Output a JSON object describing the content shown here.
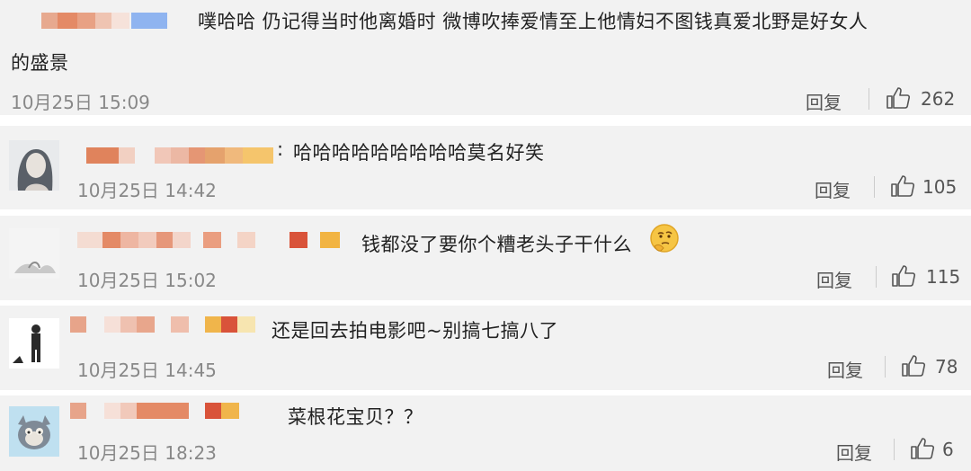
{
  "comments": [
    {
      "text_line1": "噗哈哈 仍记得当时他离婚时 微博吹捧爱情至上他情妇不图钱真爱北野是好女人",
      "text_line2": "的盛景",
      "time": "10月25日 15:09",
      "reply_label": "回复",
      "likes": "262"
    }
  ],
  "replies": [
    {
      "separator": ":",
      "text": "哈哈哈哈哈哈哈哈哈莫名好笑",
      "time": "10月25日 14:42",
      "reply_label": "回复",
      "likes": "105"
    },
    {
      "text": "钱都没了要你个糟老头子干什么",
      "emoji": "thinking-face",
      "time": "10月25日 15:02",
      "reply_label": "回复",
      "likes": "115"
    },
    {
      "text": "还是回去拍电影吧~别搞七搞八了",
      "time": "10月25日 14:45",
      "reply_label": "回复",
      "likes": "78"
    },
    {
      "text": "菜根花宝贝？？",
      "time": "10月25日 18:23",
      "reply_label": "回复",
      "likes": "6"
    }
  ],
  "icons": {
    "like": "thumbs-up-icon"
  },
  "colors": {
    "card_bg": "#f2f2f2",
    "time_gray": "#888888",
    "mosaic_orange": "#e0835c",
    "mosaic_pink": "#f0c4b4",
    "mosaic_blue": "#8fb4f0",
    "mosaic_red": "#d9533a",
    "mosaic_yellow": "#f2b442"
  }
}
